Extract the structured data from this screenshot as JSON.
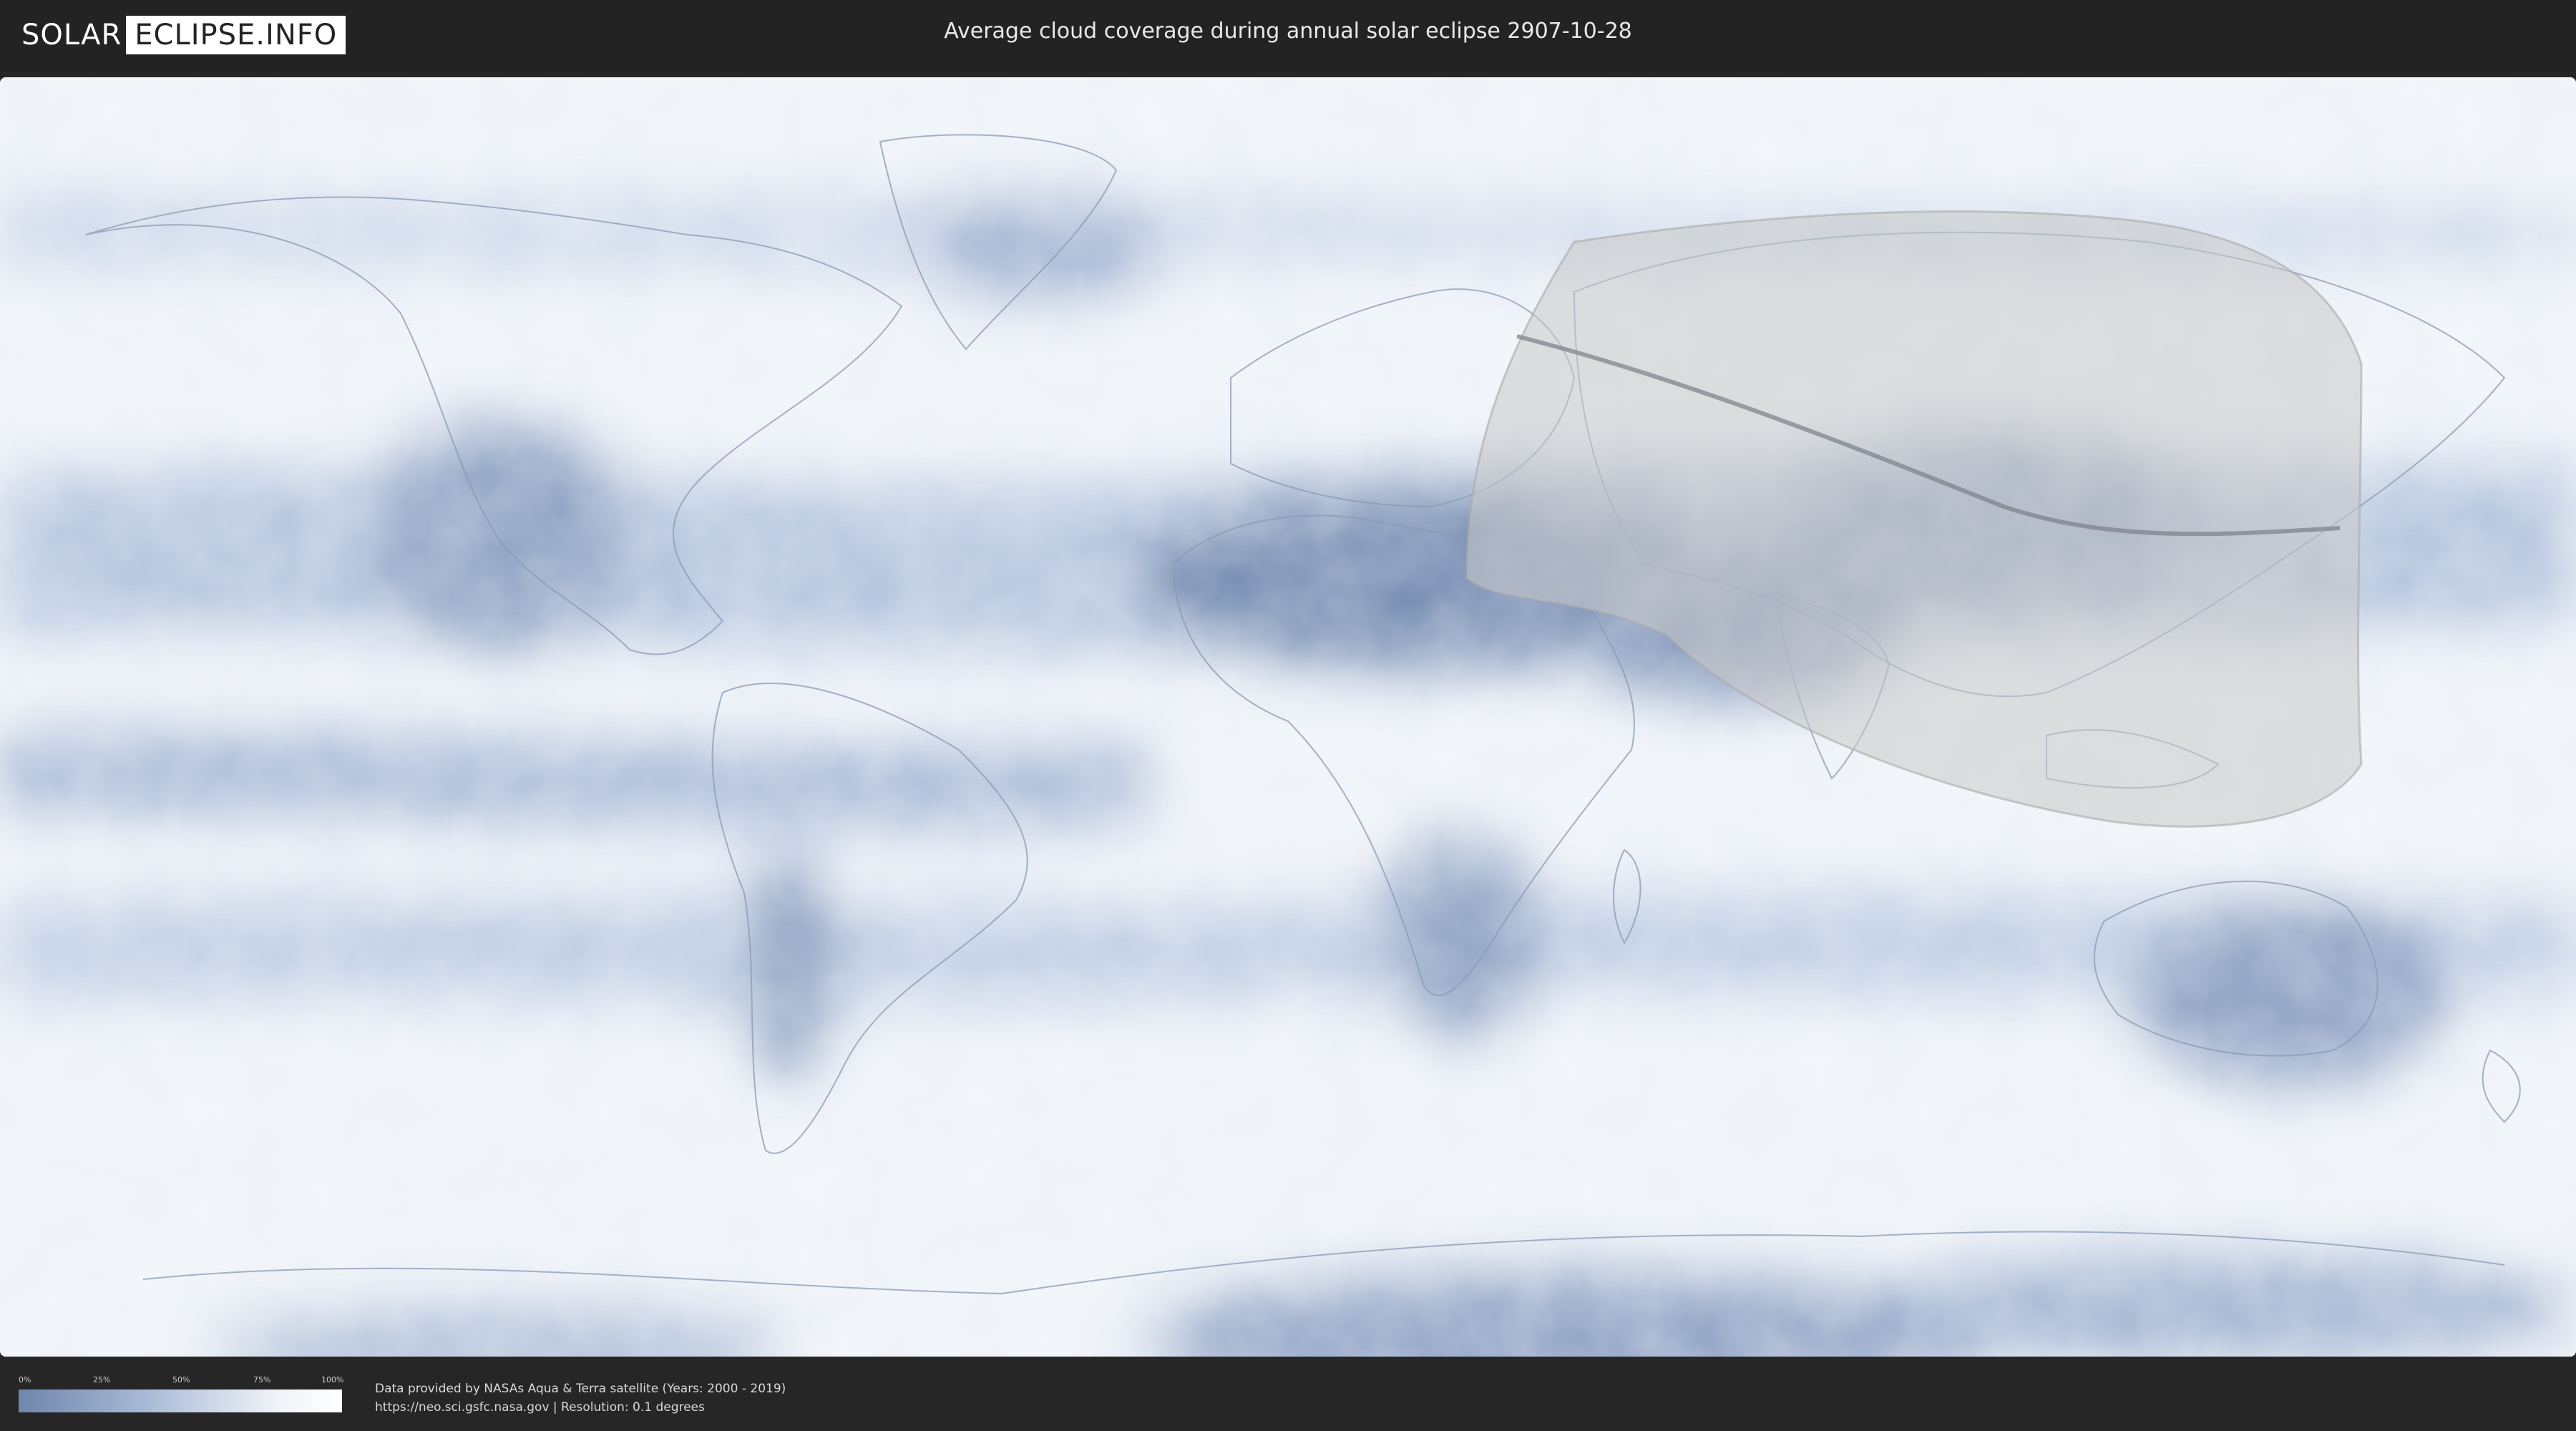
{
  "header": {
    "logo_left": "SOLAR",
    "logo_right": "ECLIPSE.INFO",
    "title": "Average cloud coverage during annual solar eclipse 2907-10-28"
  },
  "legend": {
    "ticks": [
      "0%",
      "25%",
      "50%",
      "75%",
      "100%"
    ],
    "color_low": "#6f86ad",
    "color_high": "#ffffff"
  },
  "footer": {
    "credit_line1": "Data provided by NASAs Aqua & Terra satellite (Years: 2000 - 2019)",
    "credit_line2": "https://neo.sci.gsfc.nasa.gov | Resolution: 0.1 degrees"
  },
  "colors": {
    "cloud_dense": "#ffffff",
    "cloud_sparse": "#7e95bb",
    "eclipse_overlay": "#cfcfcf",
    "central_line": "#7a7f87"
  }
}
